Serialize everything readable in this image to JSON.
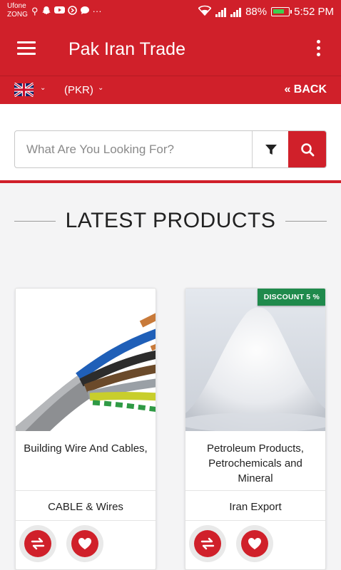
{
  "status_bar": {
    "carrier_1": "Ufone",
    "carrier_2": "ZONG",
    "battery": "88%",
    "time": "5:52 PM",
    "notification_icons": [
      "usb-icon",
      "snapchat-icon",
      "youtube-icon",
      "browser-icon",
      "message-icon",
      "more-icon"
    ],
    "status_icons": [
      "wifi-icon",
      "signal-icon",
      "signal-icon",
      "battery-charging-icon"
    ]
  },
  "app_bar": {
    "title": "Pak Iran Trade",
    "menu_icon": "hamburger-icon",
    "overflow_icon": "more-vert-icon"
  },
  "sub_bar": {
    "language_flag": "uk-flag-icon",
    "currency": "(PKR)",
    "back_label": "« BACK"
  },
  "search": {
    "placeholder": "What Are You Looking For?",
    "value": "",
    "filter_icon": "filter-icon",
    "search_icon": "search-icon"
  },
  "section": {
    "title": "LATEST PRODUCTS"
  },
  "products": [
    {
      "name": "Building Wire And Cables,",
      "category": "CABLE & Wires",
      "image": "cable-wires-photo",
      "discount": ""
    },
    {
      "name": "Petroleum Products, Petrochemicals and Mineral",
      "category": "Iran Export",
      "image": "white-powder-photo",
      "discount": "DISCOUNT 5 %"
    }
  ],
  "product_actions": {
    "compare_icon": "compare-icon",
    "wishlist_icon": "heart-icon"
  },
  "colors": {
    "primary": "#d0202a",
    "discount": "#1f8a4c",
    "background": "#f4f4f5"
  }
}
